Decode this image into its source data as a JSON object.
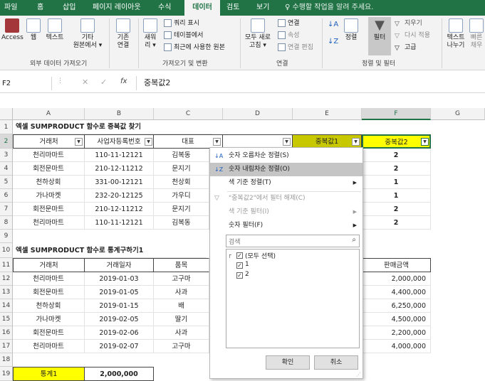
{
  "menu": {
    "tabs": [
      "파일",
      "홈",
      "삽입",
      "페이지 레이아웃",
      "수식",
      "데이터",
      "검토",
      "보기"
    ],
    "tell_me": "♀ 수행할 작업을 알려 주세요.",
    "active": "데이터"
  },
  "ribbon": {
    "access": "Access",
    "web": "웹",
    "text": "텍스트",
    "other_line1": "기타",
    "other_line2": "원본에서 ▾",
    "existing_line1": "기존",
    "existing_line2": "연결",
    "new_query_line1": "새워",
    "new_query_line2": "리 ▾",
    "show_queries": "쿼리 표시",
    "from_table": "테이블에서",
    "recent_sources": "최근에 사용한 원본",
    "refresh_line1": "모두 새로",
    "refresh_line2": "고침 ▾",
    "connections": "연결",
    "properties": "속성",
    "edit_links": "연결 편집",
    "sort": "정렬",
    "filter": "필터",
    "clear": "지우기",
    "reapply": "다시 적용",
    "advanced": "고급",
    "text_to_columns_line1": "텍스트",
    "text_to_columns_line2": "나누기",
    "flash_line1": "빠른",
    "flash_line2": "채우",
    "group_external": "외부 데이터 가져오기",
    "group_transform": "가져오기 및 변환",
    "group_connections": "연결",
    "group_sortfilter": "정렬 및 필터"
  },
  "formula_bar": {
    "name_box": "F2",
    "fx": "fx",
    "content": "중복값2"
  },
  "columns": [
    "A",
    "B",
    "C",
    "D",
    "E",
    "F",
    "G"
  ],
  "rows": {
    "r1": {
      "num": "1",
      "title": "엑셀  SUMPRODUCT 함수로 중복값 찾기"
    },
    "r2": {
      "num": "2",
      "a": "거래처",
      "b": "사업자등록번호",
      "c": "대표",
      "d": "",
      "e": "중복값1",
      "f": "중복값2"
    },
    "data1": [
      {
        "num": "3",
        "a": "천리마마트",
        "b": "110-11-12121",
        "c": "김복동",
        "f": "2"
      },
      {
        "num": "4",
        "a": "회전문마트",
        "b": "210-12-11212",
        "c": "문지기",
        "f": "2"
      },
      {
        "num": "5",
        "a": "천하상회",
        "b": "331-00-12121",
        "c": "천상회",
        "f": "1"
      },
      {
        "num": "6",
        "a": "가나마켓",
        "b": "232-20-12125",
        "c": "가우디",
        "f": "1"
      },
      {
        "num": "7",
        "a": "회전문마트",
        "b": "210-12-11212",
        "c": "문지기",
        "f": "2"
      },
      {
        "num": "8",
        "a": "천리마마트",
        "b": "110-11-12121",
        "c": "김복동",
        "f": "2"
      }
    ],
    "r9": {
      "num": "9"
    },
    "r10": {
      "num": "10",
      "title": "엑셀  SUMPRODUCT 함수로 통계구하기1"
    },
    "r11": {
      "num": "11",
      "a": "거래처",
      "b": "거래일자",
      "c": "품목",
      "f": "판매금액"
    },
    "data2": [
      {
        "num": "12",
        "a": "천리마마트",
        "b": "2019-01-03",
        "c": "고구마",
        "f": "2,000,000"
      },
      {
        "num": "13",
        "a": "회전문마트",
        "b": "2019-01-05",
        "c": "사과",
        "f": "4,400,000"
      },
      {
        "num": "14",
        "a": "천하상회",
        "b": "2019-01-15",
        "c": "배",
        "f": "6,250,000"
      },
      {
        "num": "15",
        "a": "가나마켓",
        "b": "2019-02-05",
        "c": "딸기",
        "f": "4,500,000"
      },
      {
        "num": "16",
        "a": "회전문마트",
        "b": "2019-02-06",
        "c": "사과",
        "f": "2,200,000"
      },
      {
        "num": "17",
        "a": "천리마마트",
        "b": "2019-02-07",
        "c": "고구마",
        "f": "4,000,000"
      }
    ],
    "r18": {
      "num": "18"
    },
    "r19": {
      "num": "19",
      "a": "통계1",
      "b": "2,000,000"
    }
  },
  "popup": {
    "sort_asc": "숫자 오름차순 정렬(S)",
    "sort_desc": "숫자 내림차순 정렬(O)",
    "sort_color": "색 기준 정렬(T)",
    "clear_filter": "\"중복값2\"에서 필터 해제(C)",
    "filter_color": "색 기준 필터(I)",
    "number_filter": "숫자 필터(F)",
    "search_placeholder": "검색",
    "select_all": "(모두 선택)",
    "opt1": "1",
    "opt2": "2",
    "ok": "확인",
    "cancel": "취소"
  },
  "colors": {
    "excel_green": "#217346",
    "yellow": "#ffff00",
    "olive": "#c8c800",
    "selected_border": "#217346"
  }
}
